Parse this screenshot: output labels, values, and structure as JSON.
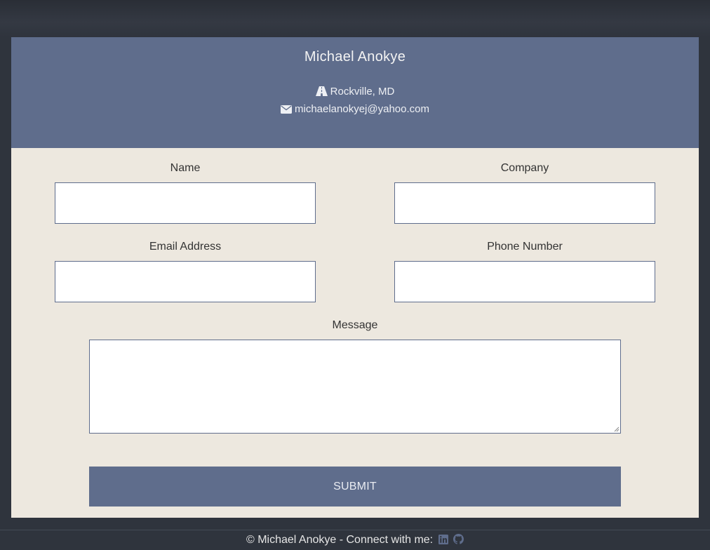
{
  "header": {
    "name": "Michael Anokye",
    "location": "Rockville, MD",
    "email": "michaelanokyej@yahoo.com"
  },
  "form": {
    "name_label": "Name",
    "company_label": "Company",
    "email_label": "Email Address",
    "phone_label": "Phone Number",
    "message_label": "Message",
    "name_value": "",
    "company_value": "",
    "email_value": "",
    "phone_value": "",
    "message_value": "",
    "submit_label": "SUBMIT"
  },
  "footer": {
    "text": "© Michael Anokye - Connect with me:"
  },
  "icons": {
    "location": "road-icon",
    "email": "envelope-icon",
    "linkedin": "linkedin-icon",
    "github": "github-icon"
  },
  "colors": {
    "accent": "#5f6d8c",
    "card_bg": "#ede8df",
    "page_bg": "#2f343d"
  }
}
